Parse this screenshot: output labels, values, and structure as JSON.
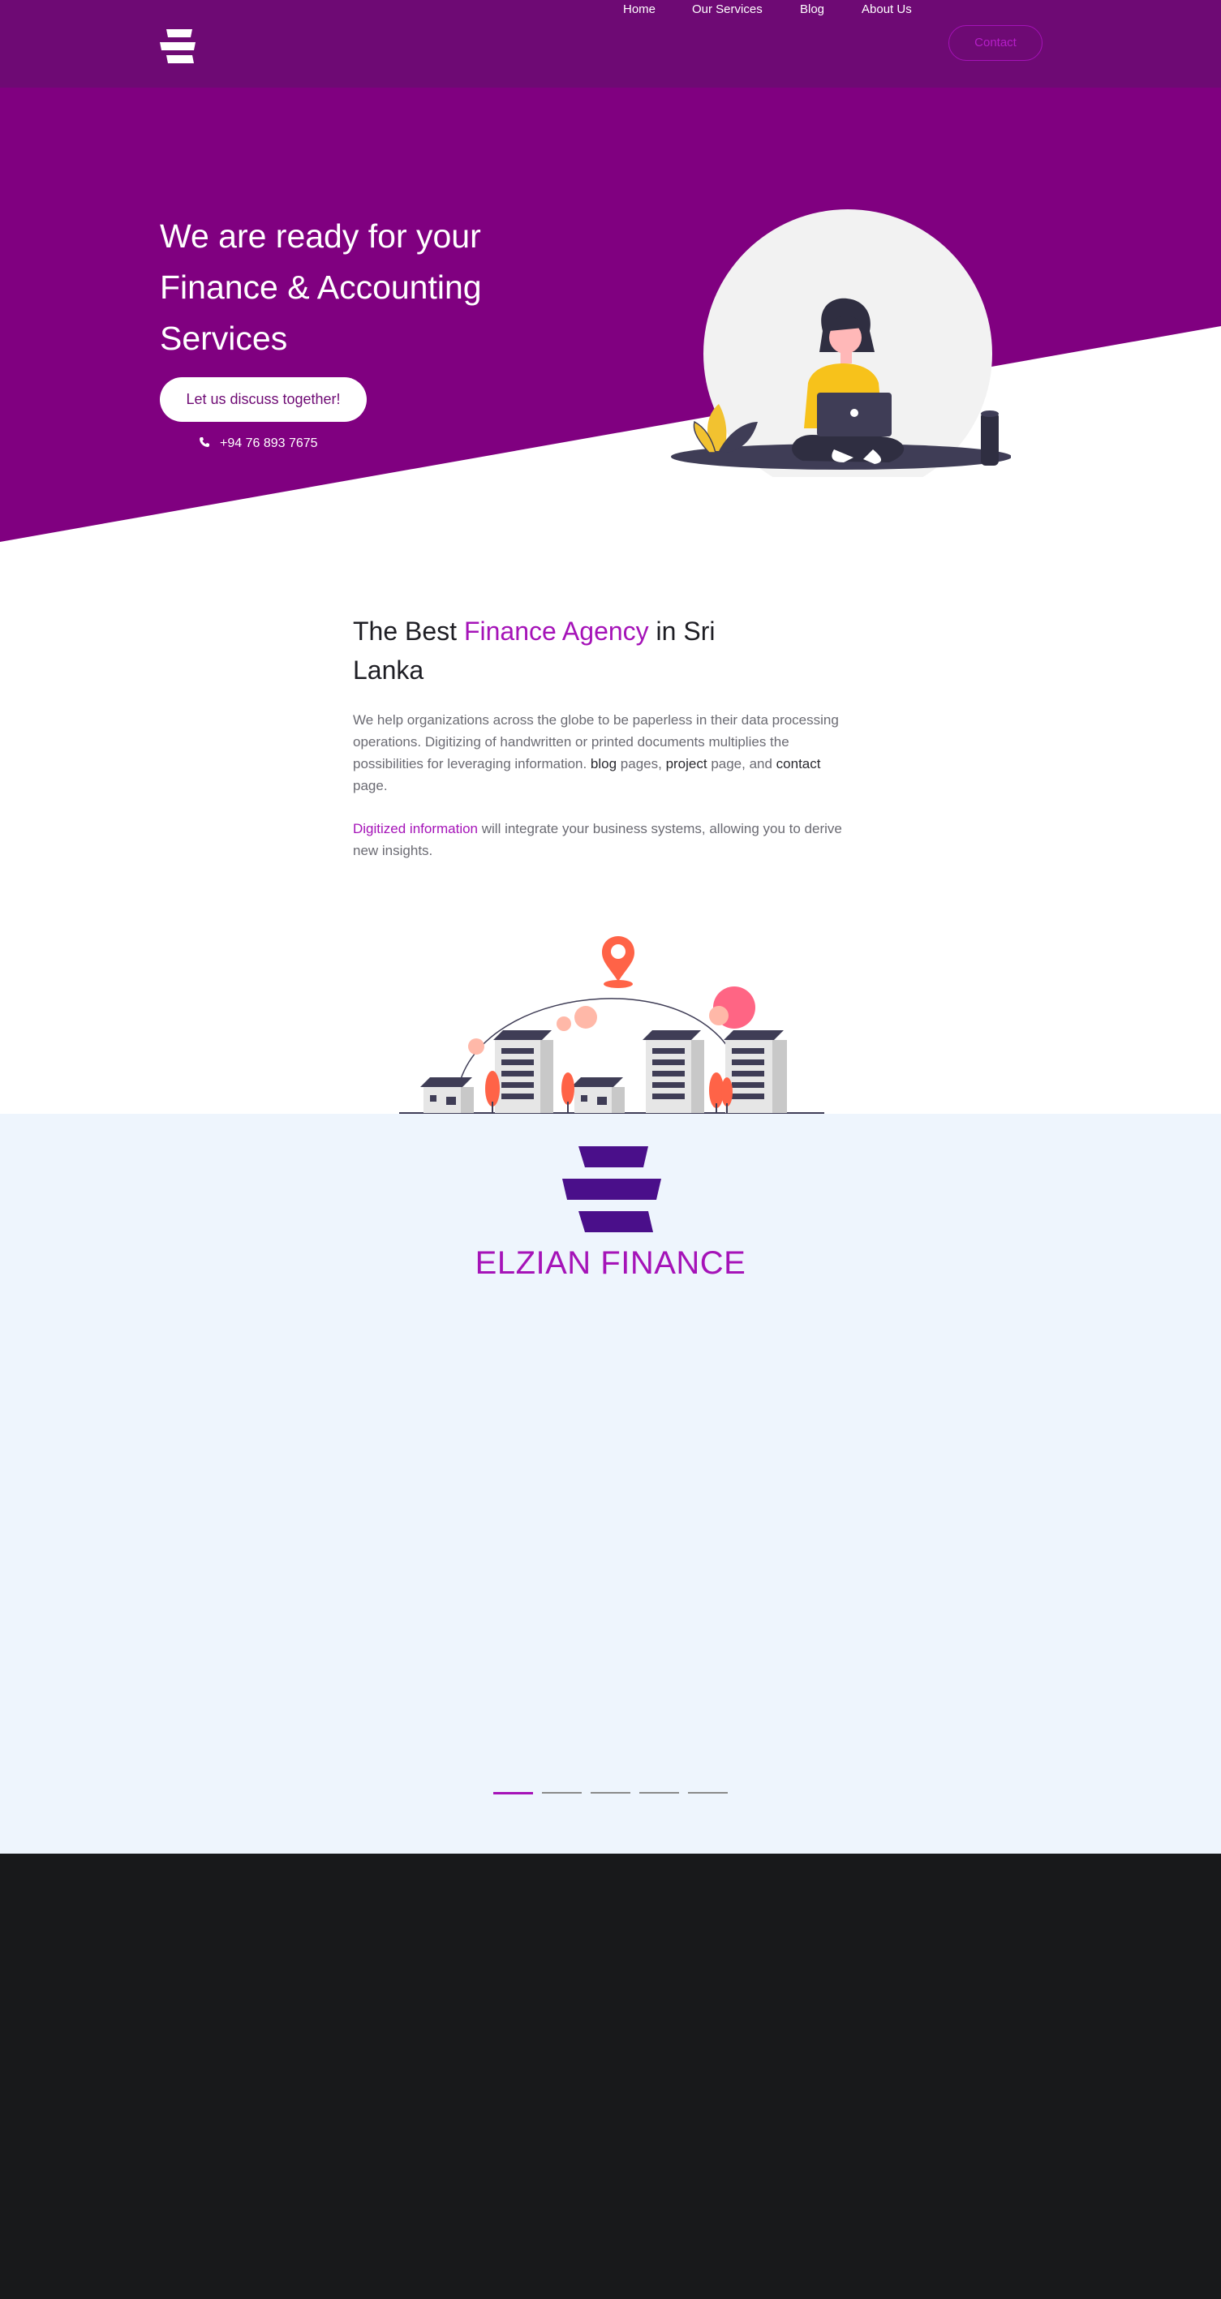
{
  "nav": {
    "links": [
      "Home",
      "Our Services",
      "Blog",
      "About Us"
    ],
    "contact_label": "Contact"
  },
  "hero": {
    "title": "We are ready for your Finance & Accounting Services",
    "cta_label": "Let us discuss together!",
    "phone": "+94 76 893 7675"
  },
  "about": {
    "title_pre": "The Best ",
    "title_accent": "Finance Agency",
    "title_post": " in Sri Lanka",
    "p1_text": "We help organizations across the globe to be paperless in their data processing operations. Digitizing of handwritten or printed documents multiplies the possibilities for leveraging information. ",
    "p1_link_blog": "blog",
    "p1_mid1": " pages, ",
    "p1_link_project": "project",
    "p1_mid2": " page, and ",
    "p1_link_contact": "contact",
    "p1_end": " page.",
    "p2_accent": "Digitized information",
    "p2_text": " will integrate your business systems, allowing you to derive new insights."
  },
  "brand": {
    "name": "ELZIAN FINANCE",
    "slides": 5,
    "active_slide": 1
  },
  "colors": {
    "nav_bg": "#6e0a74",
    "hero_bg": "#800080",
    "accent": "#a513b8",
    "brand_bg": "#eef5fd",
    "footer_bg": "#18191b",
    "logo_purple": "#4a0f8a"
  }
}
